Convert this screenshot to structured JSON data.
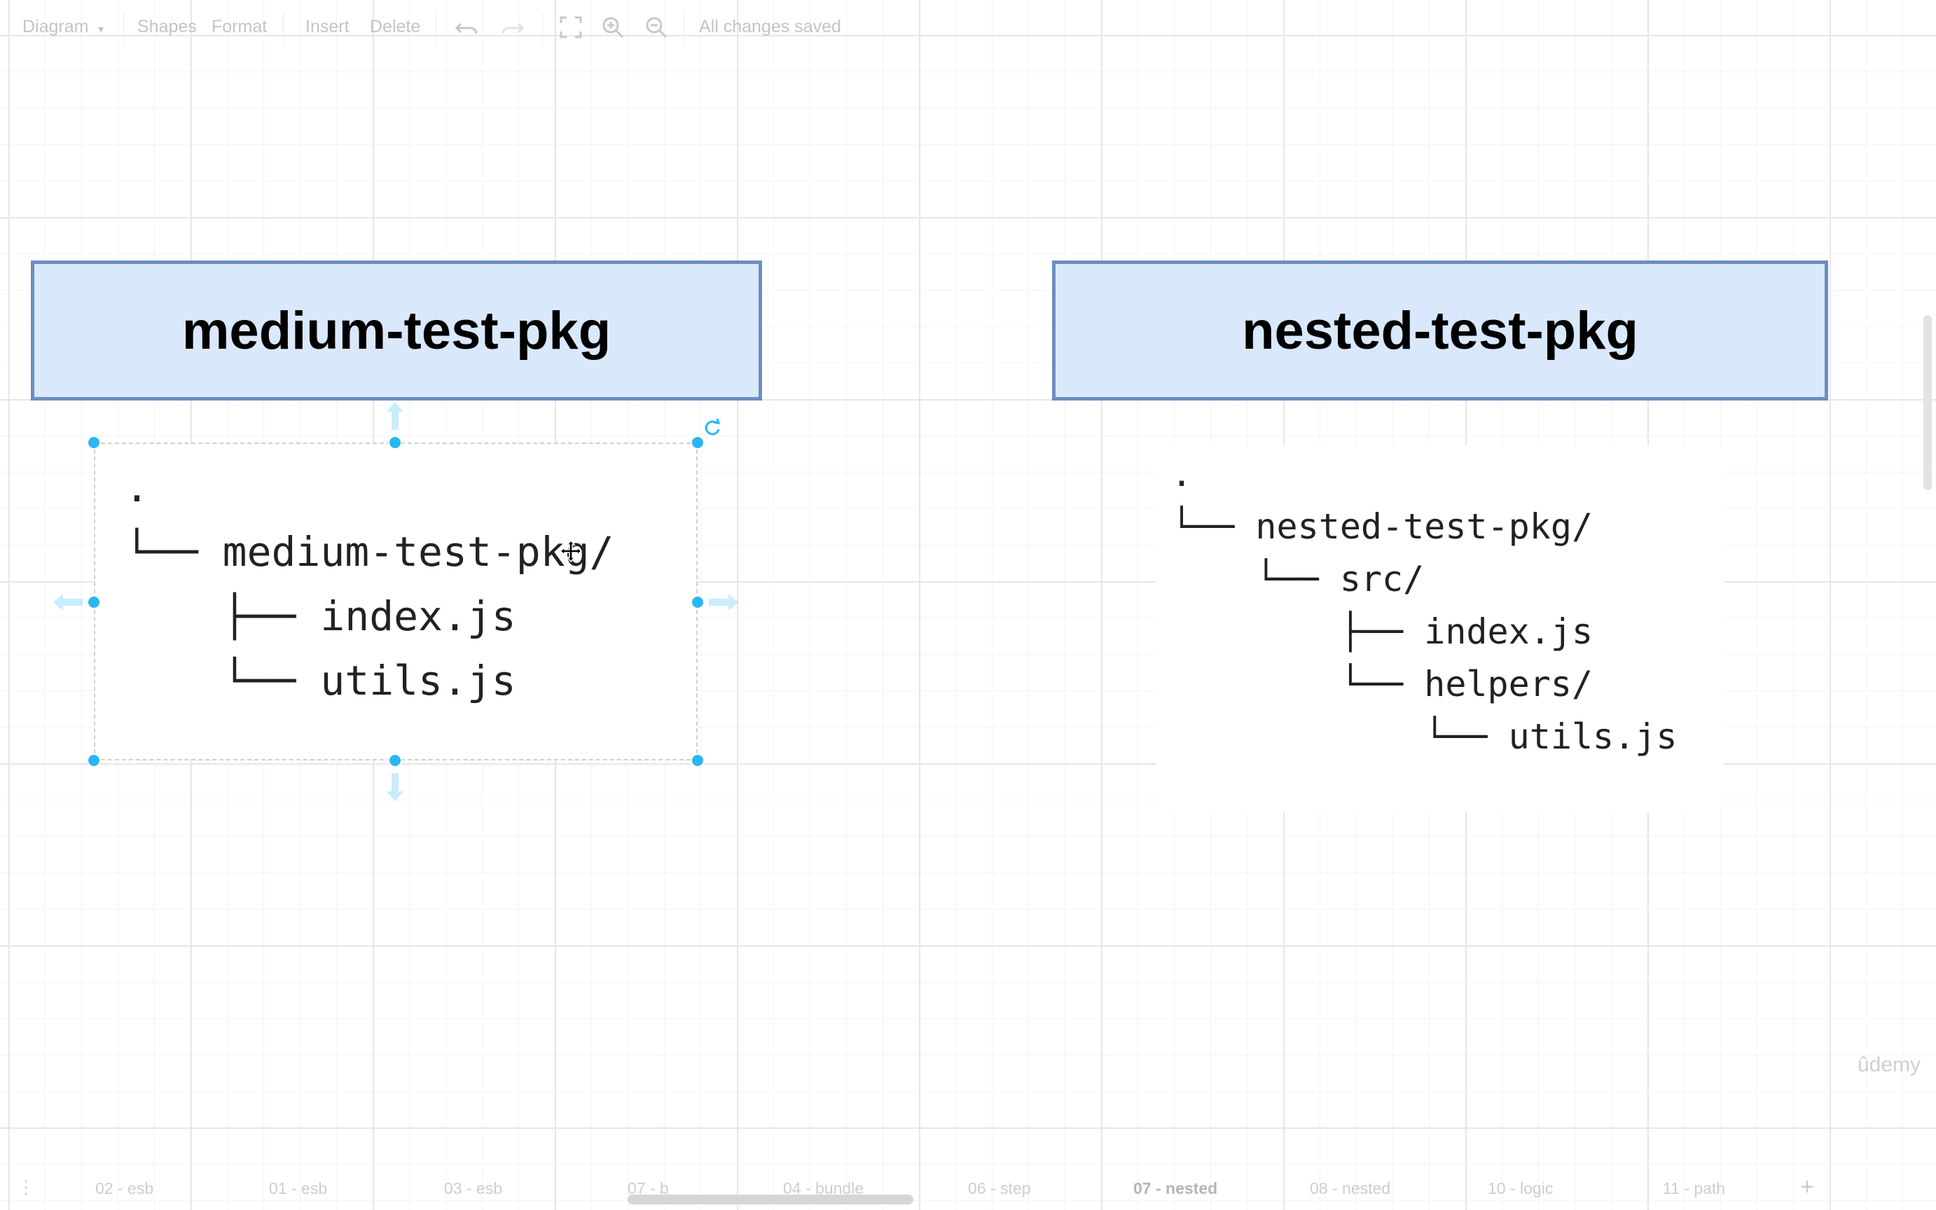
{
  "toolbar": {
    "diagram_menu": "Diagram",
    "shapes": "Shapes",
    "format": "Format",
    "insert": "Insert",
    "delete": "Delete",
    "status": "All changes saved",
    "icons": [
      "undo-icon",
      "redo-icon",
      "fullscreen-icon",
      "zoom-in-icon",
      "zoom-out-icon"
    ]
  },
  "diagram": {
    "left_box_title": "medium-test-pkg",
    "right_box_title": "nested-test-pkg",
    "left_tree": [
      ".",
      "└── medium-test-pkg/",
      "    ├── index.js",
      "    └── utils.js"
    ],
    "right_tree": [
      ".",
      "└── nested-test-pkg/",
      "    └── src/",
      "        ├── index.js",
      "        └── helpers/",
      "            └── utils.js"
    ],
    "box_fill": "#dae8fc",
    "box_stroke": "#6c8ebf",
    "handle_color": "#29b6f2"
  },
  "tabs": {
    "items": [
      "02 - esb",
      "01 - esb",
      "03 - esb",
      "07 - b",
      "04 - bundle",
      "06 - step",
      "07 - nested",
      "08 - nested",
      "10 - logic",
      "11 - path"
    ],
    "active": "07 - nested",
    "add_label": "+"
  },
  "watermark": "ûdemy"
}
